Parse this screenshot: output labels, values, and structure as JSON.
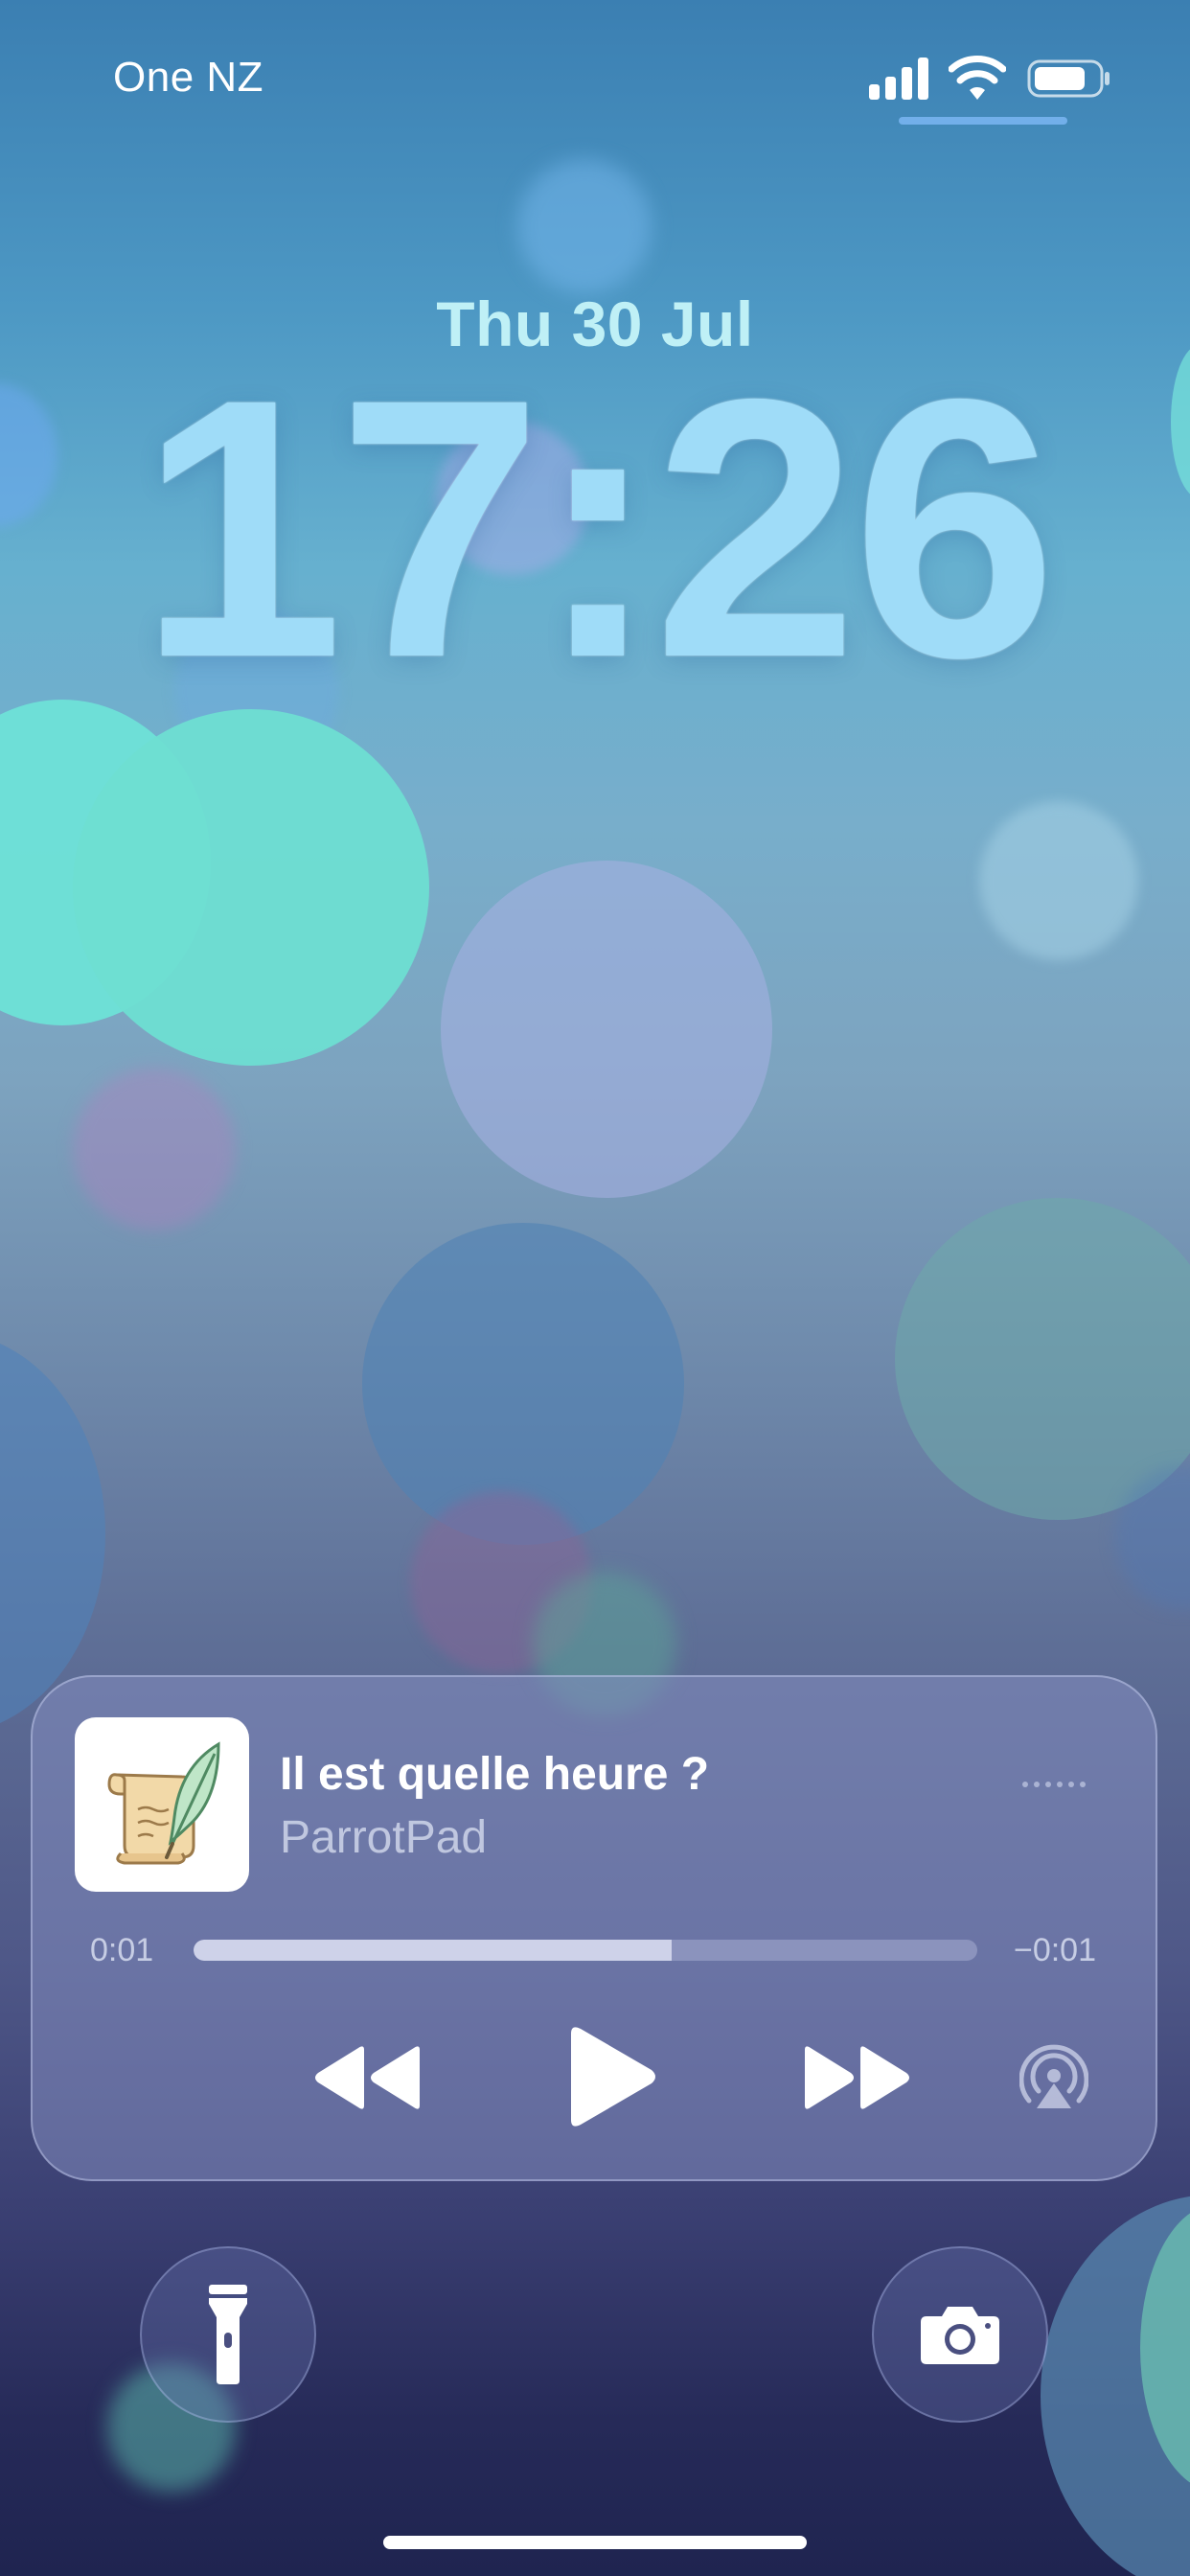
{
  "status_bar": {
    "carrier": "One NZ",
    "icons": [
      "signal-icon",
      "wifi-icon",
      "battery-icon"
    ]
  },
  "lock_screen": {
    "date": "Thu 30 Jul",
    "time": "17:26"
  },
  "now_playing": {
    "title": "Il est quelle heure ?",
    "artist": "ParrotPad",
    "elapsed": "0:01",
    "remaining": "−0:01",
    "progress": 0.61,
    "controls": [
      "rewind-icon",
      "play-icon",
      "fast-forward-icon",
      "airplay-icon"
    ],
    "artwork": "scroll-and-quill-icon"
  },
  "quick_actions": {
    "left": "flashlight-icon",
    "right": "camera-icon"
  },
  "colors": {
    "clock": "#9fdcf8",
    "date": "#bff0f6",
    "card_background": "#848ec0"
  }
}
